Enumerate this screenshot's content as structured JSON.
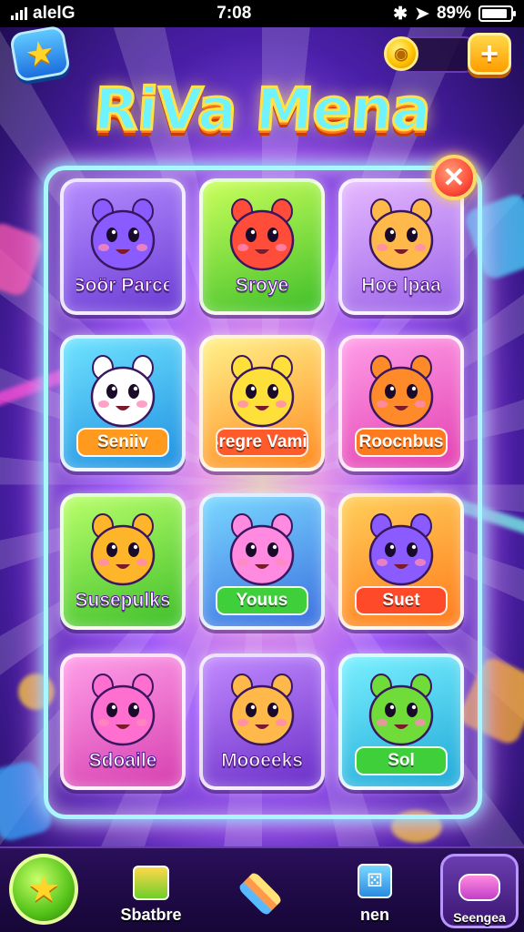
{
  "status_bar": {
    "carrier": "alelG",
    "time": "7:08",
    "battery_text": "89%",
    "battery_level": 0.89
  },
  "header": {
    "title": "RiVa Mena",
    "star_icon": "star-icon",
    "plus_label": "+",
    "coin_icon": "coin-icon"
  },
  "tiles": [
    {
      "label": "Soör Parce",
      "label_style": "plain",
      "bg": [
        "#b68cff",
        "#6a3dd4"
      ],
      "label_bg": "",
      "char": "purple-bunny",
      "char_color": "#8a5cff"
    },
    {
      "label": "Sroye",
      "label_style": "plain",
      "bg": [
        "#c9ff5a",
        "#3fbf2a"
      ],
      "label_bg": "",
      "char": "red-bear",
      "char_color": "#ff4d3a"
    },
    {
      "label": "Hoe lpaa",
      "label_style": "plain",
      "bg": [
        "#e6b8ff",
        "#9a63e8"
      ],
      "label_bg": "",
      "char": "rainbow-swirl",
      "char_color": "#ffb84a"
    },
    {
      "label": "Seniiv",
      "label_style": "pill",
      "bg": [
        "#6fe3ff",
        "#1f8fe0"
      ],
      "label_bg": "#ff9a1f",
      "char": "white-dragon",
      "char_color": "#ffffff"
    },
    {
      "label": "Sregre Vamie",
      "label_style": "pill",
      "bg": [
        "#fff18a",
        "#ff8a1f"
      ],
      "label_bg": "#ff5a2a",
      "char": "yellow-blob",
      "char_color": "#ffe03a"
    },
    {
      "label": "Roocnbus",
      "label_style": "pill",
      "bg": [
        "#ff9ee8",
        "#e23fb0"
      ],
      "label_bg": "#ff7a1f",
      "char": "candy-tools",
      "char_color": "#ff8a2a"
    },
    {
      "label": "Susepulks",
      "label_style": "plain",
      "bg": [
        "#b8ff6a",
        "#3fbf2a"
      ],
      "label_bg": "",
      "char": "orange-bear",
      "char_color": "#ffb52a"
    },
    {
      "label": "Youus",
      "label_style": "pill",
      "bg": [
        "#7ad8ff",
        "#3a6fe0"
      ],
      "label_bg": "#3fcf3a",
      "char": "pink-bear",
      "char_color": "#ff8ae0"
    },
    {
      "label": "Suet",
      "label_style": "pill",
      "bg": [
        "#ffcf5a",
        "#ff7a1a"
      ],
      "label_bg": "#ff4a2a",
      "char": "purple-bunny",
      "char_color": "#8a5cff"
    },
    {
      "label": "Sdoaile",
      "label_style": "plain",
      "bg": [
        "#ff9ee8",
        "#d63fb0"
      ],
      "label_bg": "",
      "char": "rainbow-heart",
      "char_color": "#ff6fd0"
    },
    {
      "label": "Mooeeks",
      "label_style": "plain",
      "bg": [
        "#c28aff",
        "#6a2fc8"
      ],
      "label_bg": "",
      "char": "rainbow-candy",
      "char_color": "#ffb84a"
    },
    {
      "label": "Sol",
      "label_style": "pill",
      "bg": [
        "#7af0ff",
        "#1fa8d8"
      ],
      "label_bg": "#3fcf3a",
      "char": "green-frog",
      "char_color": "#6fdc3a"
    }
  ],
  "bottom_nav": [
    {
      "label": "",
      "icon": "star-badge-icon"
    },
    {
      "label": "Sbatbre",
      "icon": "gift-box-icon"
    },
    {
      "label": "",
      "icon": "layers-icon"
    },
    {
      "label": "nen",
      "icon": "dice-icon"
    },
    {
      "label": "Seengea",
      "icon": "candy-jar-icon"
    }
  ],
  "colors": {
    "board_border": "#aaf6ff",
    "title_fill": "#6ff3ff",
    "title_stroke": "#ffe24a"
  }
}
